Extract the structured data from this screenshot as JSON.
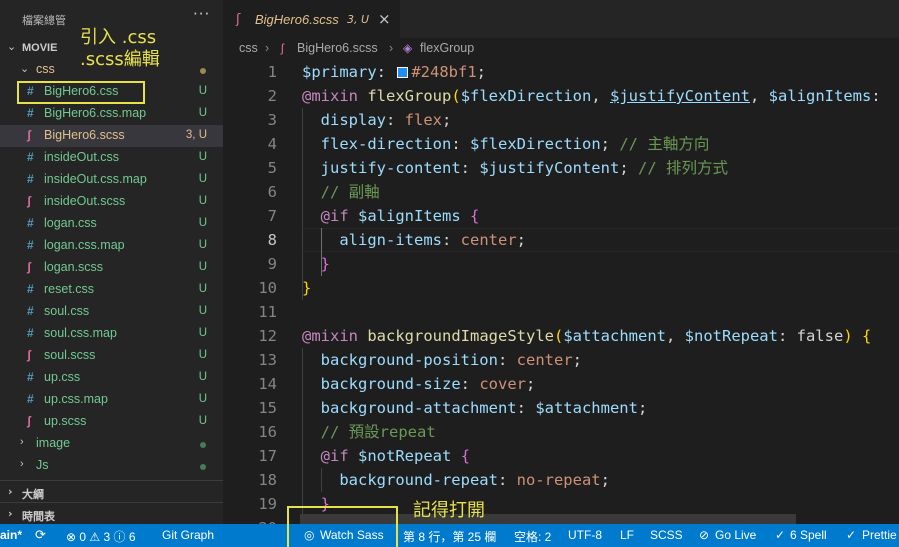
{
  "sidebar": {
    "header": "檔案總管",
    "more": "···",
    "folder": "MOVIE",
    "subfolder": "css",
    "files": [
      {
        "name": "BigHero6.css",
        "icon": "#",
        "status": "U"
      },
      {
        "name": "BigHero6.css.map",
        "icon": "#",
        "status": "U"
      },
      {
        "name": "BigHero6.scss",
        "icon": "sass",
        "status": "3, U"
      },
      {
        "name": "insideOut.css",
        "icon": "#",
        "status": "U"
      },
      {
        "name": "insideOut.css.map",
        "icon": "#",
        "status": "U"
      },
      {
        "name": "insideOut.scss",
        "icon": "sass",
        "status": "U"
      },
      {
        "name": "logan.css",
        "icon": "#",
        "status": "U"
      },
      {
        "name": "logan.css.map",
        "icon": "#",
        "status": "U"
      },
      {
        "name": "logan.scss",
        "icon": "sass",
        "status": "U"
      },
      {
        "name": "reset.css",
        "icon": "#",
        "status": "U"
      },
      {
        "name": "soul.css",
        "icon": "#",
        "status": "U"
      },
      {
        "name": "soul.css.map",
        "icon": "#",
        "status": "U"
      },
      {
        "name": "soul.scss",
        "icon": "sass",
        "status": "U"
      },
      {
        "name": "up.css",
        "icon": "#",
        "status": "U"
      },
      {
        "name": "up.css.map",
        "icon": "#",
        "status": "U"
      },
      {
        "name": "up.scss",
        "icon": "sass",
        "status": "U"
      }
    ],
    "folders_after": [
      "image",
      "Js"
    ],
    "sections": [
      "大綱",
      "時間表"
    ]
  },
  "annotations": {
    "top": "引入 .css\n.scss編輯",
    "bottom": "記得打開"
  },
  "tab": {
    "name": "BigHero6.scss",
    "status": "3, U",
    "close": "×"
  },
  "breadcrumb": [
    "css",
    "BigHero6.scss",
    "flexGroup"
  ],
  "editor": {
    "line_numbers": [
      "1",
      "2",
      "3",
      "4",
      "5",
      "6",
      "7",
      "8",
      "9",
      "10",
      "11",
      "12",
      "13",
      "14",
      "15",
      "16",
      "17",
      "18",
      "19",
      "20"
    ],
    "current_line": "8",
    "primary_color": "#248bf1"
  },
  "statusbar": {
    "branch": "ain*",
    "sync": "⟳",
    "problems": "⊗ 0 ⚠ 3 ⓘ 6",
    "git_graph": "Git Graph",
    "watch_sass": "Watch Sass",
    "position": "第 8 行，第 25 欄",
    "spaces": "空格: 2",
    "encoding": "UTF-8",
    "eol": "LF",
    "language": "SCSS",
    "go_live": "Go Live",
    "spell": "6 Spell",
    "prettier": "Prettie"
  },
  "colors": {
    "accent": "#007acc",
    "modified": "#e2c08d",
    "untracked": "#73c991",
    "highlight": "#e8e24a"
  }
}
